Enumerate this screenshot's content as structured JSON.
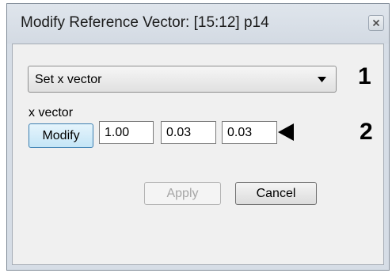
{
  "window": {
    "title": "Modify Reference Vector: [15:12] p14",
    "close_icon": "close-icon"
  },
  "combo": {
    "value": "Set x vector",
    "icon": "dropdown-arrow-icon"
  },
  "markers": {
    "one": "1",
    "two": "2"
  },
  "vector": {
    "label": "x vector",
    "modify_label": "Modify",
    "values": [
      "1.00",
      "0.03",
      "0.03"
    ],
    "pointer_icon": "pointer-arrow-icon"
  },
  "buttons": {
    "apply_label": "Apply",
    "cancel_label": "Cancel"
  }
}
